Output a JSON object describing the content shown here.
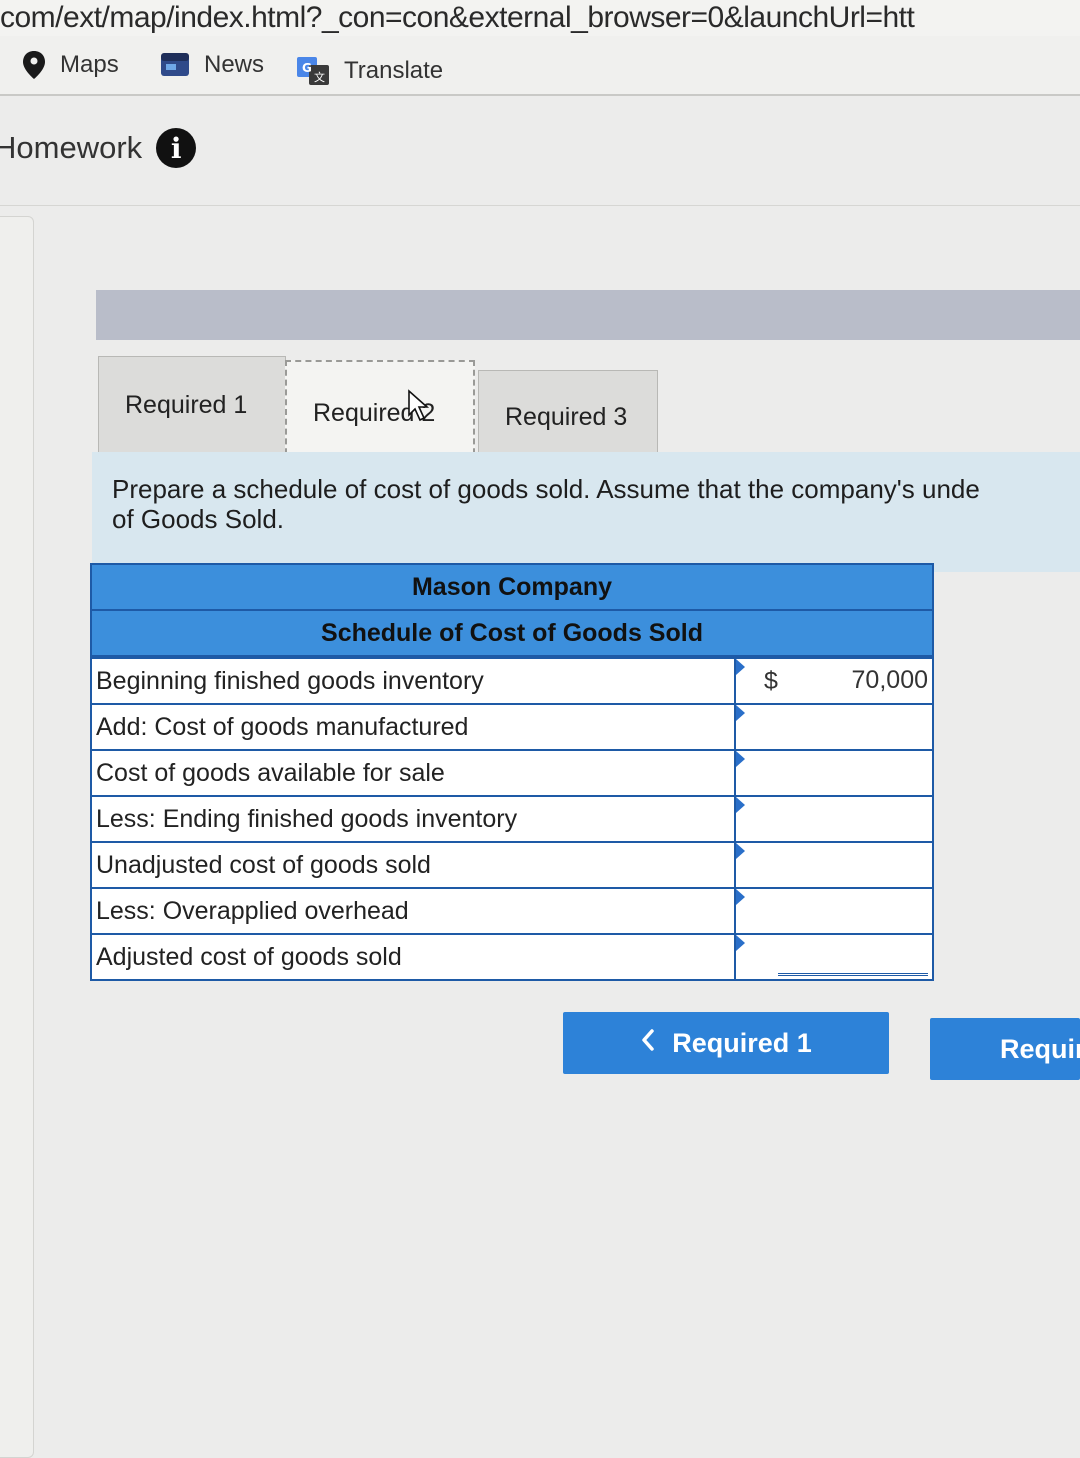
{
  "browser": {
    "url": "com/ext/map/index.html?_con=con&external_browser=0&launchUrl=htt"
  },
  "bookmarks": [
    {
      "label": "Maps",
      "icon": "map-pin-icon"
    },
    {
      "label": "News",
      "icon": "news-icon"
    },
    {
      "label": "Translate",
      "icon": "translate-icon"
    }
  ],
  "header": {
    "title": "Homework",
    "info_icon": "i"
  },
  "tabs": [
    {
      "label": "Required 1",
      "active": false
    },
    {
      "label": "Required 2",
      "active": true
    },
    {
      "label": "Required 3",
      "active": false
    }
  ],
  "instruction": {
    "line1": "Prepare a schedule of cost of goods sold. Assume that the company's unde",
    "line2": "of Goods Sold."
  },
  "schedule": {
    "company": "Mason Company",
    "title": "Schedule of Cost of Goods Sold",
    "rows": [
      {
        "label": "Beginning finished goods inventory",
        "currency": "$",
        "value": "70,000"
      },
      {
        "label": "Add: Cost of goods manufactured",
        "currency": "",
        "value": ""
      },
      {
        "label": "Cost of goods available for sale",
        "currency": "",
        "value": ""
      },
      {
        "label": "Less: Ending finished goods inventory",
        "currency": "",
        "value": ""
      },
      {
        "label": "Unadjusted cost of goods sold",
        "currency": "",
        "value": ""
      },
      {
        "label": "Less: Overapplied overhead",
        "currency": "",
        "value": ""
      },
      {
        "label": "Adjusted cost of goods sold",
        "currency": "",
        "value": ""
      }
    ]
  },
  "navigation": {
    "prev_label": "Required 1",
    "next_label": "Requir"
  },
  "colors": {
    "accent": "#2d82d8",
    "table_header": "#3c8fdc",
    "instruction_bg": "#d8e7ef"
  }
}
